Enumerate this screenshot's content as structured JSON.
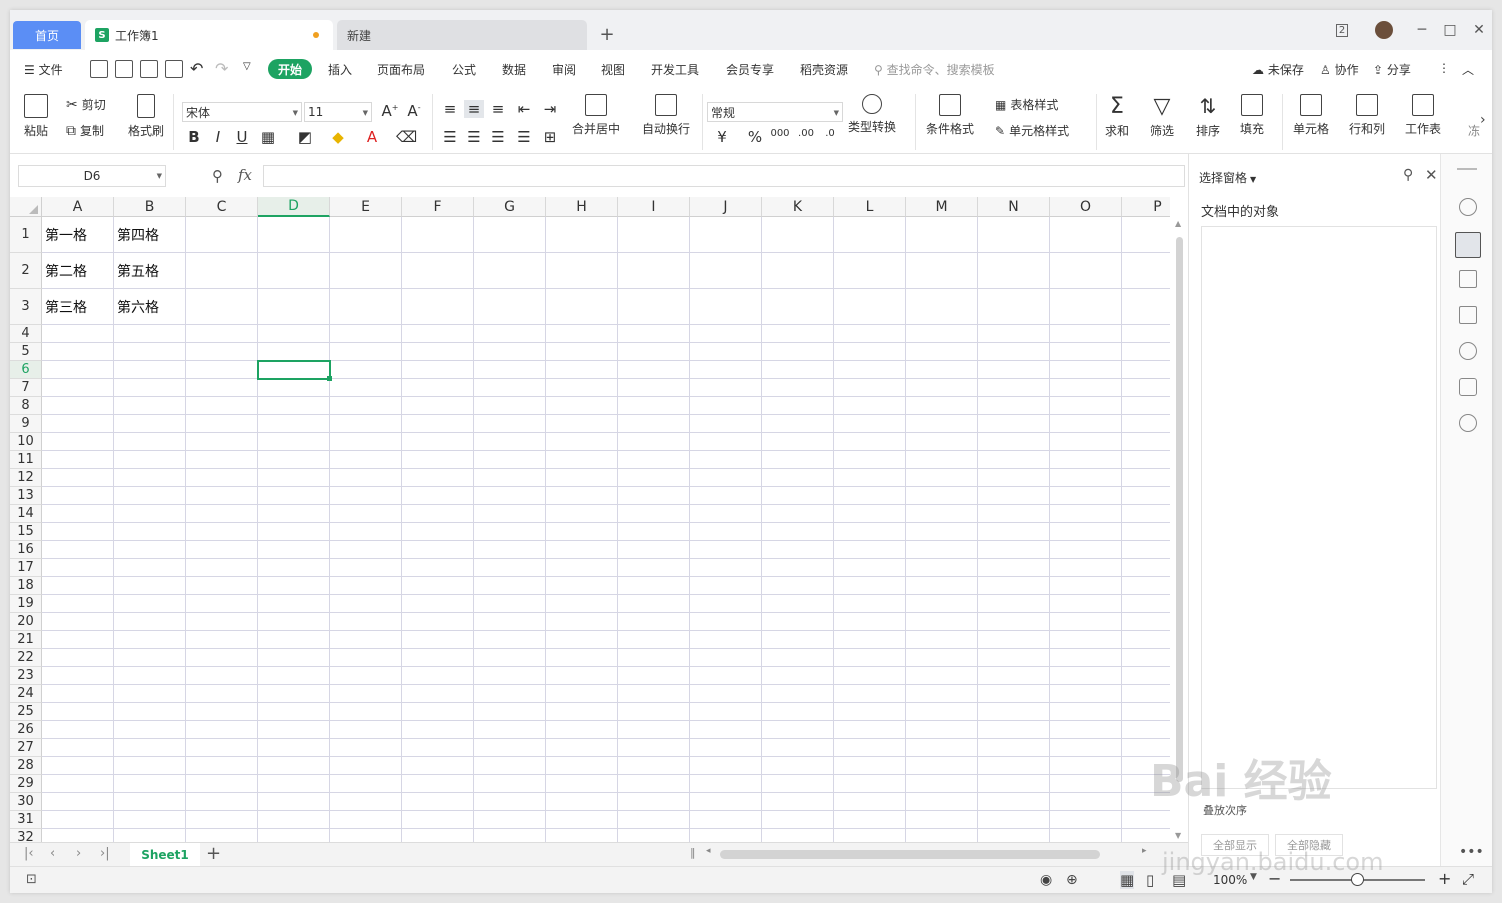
{
  "tabs": {
    "home": "首页",
    "doc": "工作簿1",
    "new": "新建",
    "add": "+"
  },
  "menu": {
    "file": "文件",
    "items": [
      "开始",
      "插入",
      "页面布局",
      "公式",
      "数据",
      "审阅",
      "视图",
      "开发工具",
      "会员专享",
      "稻壳资源"
    ],
    "search_placeholder": "查找命令、搜索模板",
    "unsaved": "未保存",
    "collab": "协作",
    "share": "分享"
  },
  "ribbon": {
    "paste": "粘贴",
    "cut": "剪切",
    "copy": "复制",
    "format_painter": "格式刷",
    "font": "宋体",
    "font_size": "11",
    "number_format": "常规",
    "merge_center": "合并居中",
    "wrap_text": "自动换行",
    "type_convert": "类型转换",
    "cond_format": "条件格式",
    "table_style": "表格样式",
    "cell_style": "单元格样式",
    "sum": "求和",
    "filter": "筛选",
    "sort": "排序",
    "fill": "填充",
    "cell": "单元格",
    "row_col": "行和列",
    "worksheet": "工作表",
    "more": "冻"
  },
  "formula_bar": {
    "name_box": "D6",
    "fx": "fx",
    "value": ""
  },
  "sheet": {
    "columns": [
      "A",
      "B",
      "C",
      "D",
      "E",
      "F",
      "G",
      "H",
      "I",
      "J",
      "K",
      "L",
      "M",
      "N",
      "O",
      "P"
    ],
    "active_col": "D",
    "active_row": 6,
    "rows": [
      "1",
      "2",
      "3",
      "4",
      "5",
      "6",
      "7",
      "8",
      "9",
      "10",
      "11",
      "12",
      "13",
      "14",
      "15",
      "16",
      "17",
      "18",
      "19",
      "20",
      "21",
      "22",
      "23",
      "24",
      "25",
      "26",
      "27",
      "28",
      "29",
      "30",
      "31",
      "32"
    ],
    "cells": {
      "A1": "第一格",
      "B1": "第四格",
      "A2": "第二格",
      "B2": "第五格",
      "A3": "第三格",
      "B3": "第六格"
    },
    "sheet_tab": "Sheet1"
  },
  "status": {
    "zoom": "100%"
  },
  "pane": {
    "title": "选择窗格",
    "subtitle": "文档中的对象",
    "footer": "叠放次序",
    "show_all": "全部显示",
    "hide_all": "全部隐藏"
  },
  "watermark": {
    "line1": "Bai 经验",
    "line2": "jingyan.baidu.com"
  },
  "colors": {
    "accent": "#1da362",
    "home_tab": "#5b8ef5"
  }
}
